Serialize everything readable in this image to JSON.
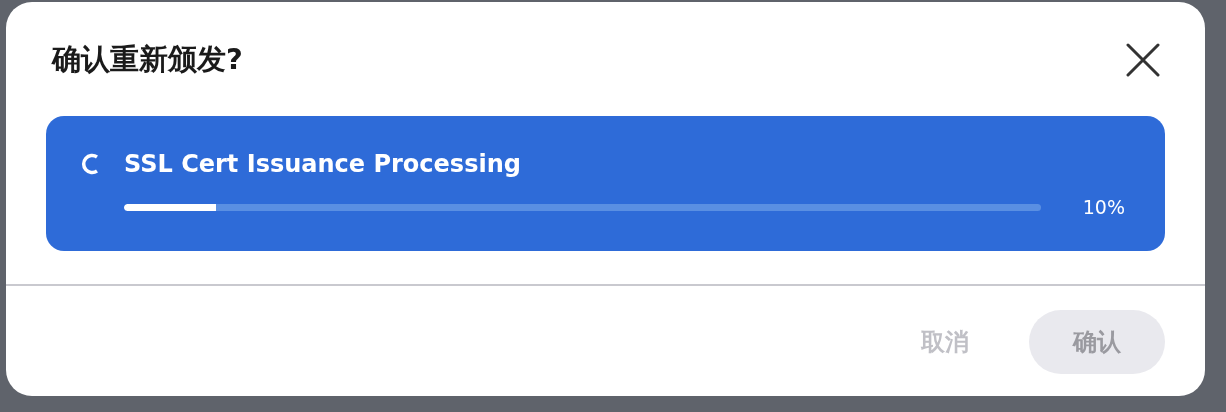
{
  "dialog": {
    "title": "确认重新颁发?"
  },
  "task": {
    "label": "SSL Cert Issuance Processing",
    "level": 0.1,
    "percent": "10%"
  },
  "buttons": [
    {
      "label": "取消",
      "kind": "text",
      "disabled": true
    },
    {
      "label": "确认",
      "kind": "filled",
      "disabled": true
    }
  ]
}
